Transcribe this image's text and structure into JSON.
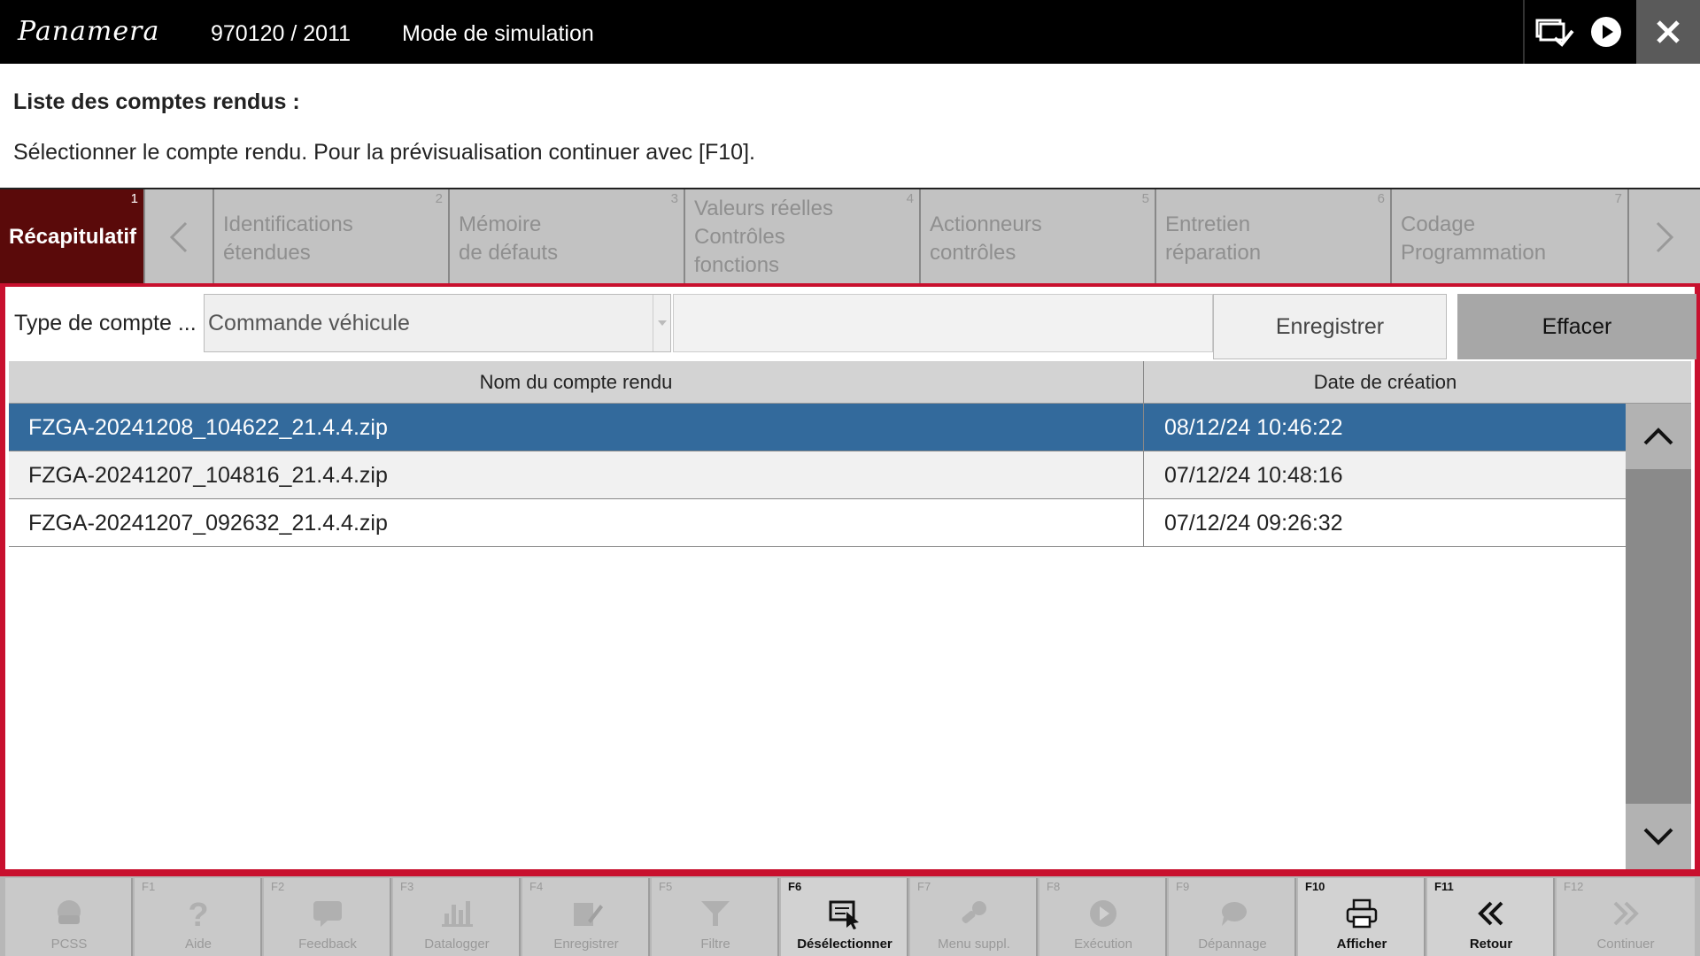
{
  "titlebar": {
    "brand": "Panamera",
    "vehicle_id": "970120 / 2011",
    "mode": "Mode de simulation"
  },
  "heading": "Liste des comptes rendus :",
  "instruction": "Sélectionner le compte rendu. Pour la prévisualisation continuer avec [F10].",
  "tabs": [
    {
      "num": "1",
      "label": "Récapitulatif",
      "active": true
    },
    {
      "num": "2",
      "label": "Identifications\nétendues"
    },
    {
      "num": "3",
      "label": "Mémoire\nde défauts"
    },
    {
      "num": "4",
      "label": "Valeurs réelles\nContrôles\nfonctions"
    },
    {
      "num": "5",
      "label": "Actionneurs\ncontrôles"
    },
    {
      "num": "6",
      "label": "Entretien\nréparation"
    },
    {
      "num": "7",
      "label": "Codage\nProgrammation"
    }
  ],
  "form": {
    "type_label": "Type de compte ...",
    "type_value": "Commande véhicule",
    "name_value": "",
    "save_button": "Enregistrer",
    "clear_button": "Effacer"
  },
  "table": {
    "columns": [
      "Nom du compte rendu",
      "Date de création"
    ],
    "rows": [
      {
        "name": "FZGA-20241208_104622_21.4.4.zip",
        "date": "08/12/24 10:46:22",
        "selected": true
      },
      {
        "name": "FZGA-20241207_104816_21.4.4.zip",
        "date": "07/12/24 10:48:16"
      },
      {
        "name": "FZGA-20241207_092632_21.4.4.zip",
        "date": "07/12/24 09:26:32"
      }
    ]
  },
  "fkeys": [
    {
      "key": "",
      "label": "PCSS",
      "icon": "pcss-icon",
      "enabled": false
    },
    {
      "key": "F1",
      "label": "Aide",
      "icon": "help-icon",
      "enabled": false
    },
    {
      "key": "F2",
      "label": "Feedback",
      "icon": "feedback-icon",
      "enabled": false
    },
    {
      "key": "F3",
      "label": "Datalogger",
      "icon": "datalogger-icon",
      "enabled": false
    },
    {
      "key": "F4",
      "label": "Enregistrer",
      "icon": "save-icon",
      "enabled": false
    },
    {
      "key": "F5",
      "label": "Filtre",
      "icon": "filter-icon",
      "enabled": false
    },
    {
      "key": "F6",
      "label": "Désélectionner",
      "icon": "deselect-icon",
      "enabled": true
    },
    {
      "key": "F7",
      "label": "Menu suppl.",
      "icon": "extra-menu-icon",
      "enabled": false
    },
    {
      "key": "F8",
      "label": "Exécution",
      "icon": "execute-icon",
      "enabled": false
    },
    {
      "key": "F9",
      "label": "Dépannage",
      "icon": "troubleshoot-icon",
      "enabled": false
    },
    {
      "key": "F10",
      "label": "Afficher",
      "icon": "print-icon",
      "enabled": true
    },
    {
      "key": "F11",
      "label": "Retour",
      "icon": "back-icon",
      "enabled": true
    },
    {
      "key": "F12",
      "label": "Continuer",
      "icon": "continue-icon",
      "enabled": false
    }
  ]
}
